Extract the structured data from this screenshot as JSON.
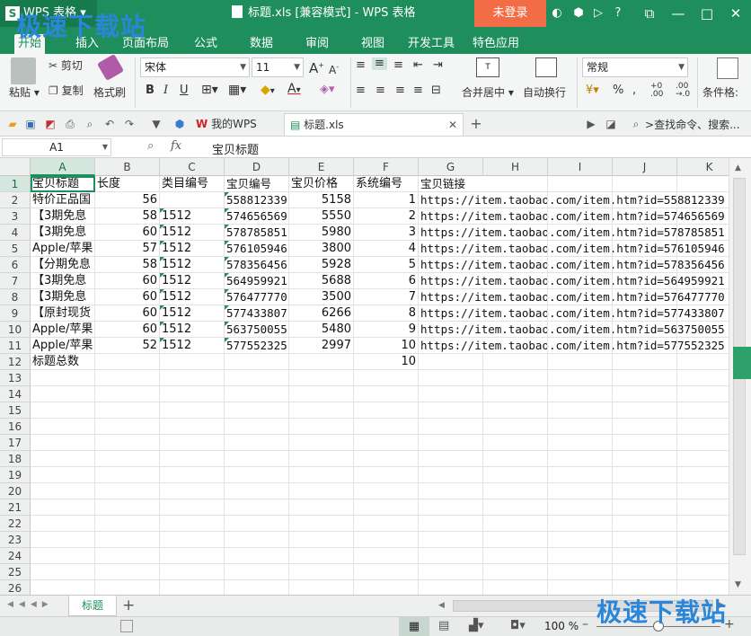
{
  "app": {
    "name": "WPS 表格",
    "window_title": "标题.xls [兼容模式] - WPS 表格",
    "login": "未登录"
  },
  "watermark": "极速下载站",
  "tabs": [
    "开始",
    "插入",
    "页面布局",
    "公式",
    "数据",
    "审阅",
    "视图",
    "开发工具",
    "特色应用"
  ],
  "ribbon": {
    "paste": "粘贴",
    "cut": "剪切",
    "copy": "复制",
    "format_painter": "格式刷",
    "font_name": "宋体",
    "font_size": "11",
    "bold": "B",
    "italic": "I",
    "underline": "U",
    "merge_center": "合并居中",
    "wrap_text": "自动换行",
    "number_format": "常规",
    "percent": "%",
    "conditional": "条件格:"
  },
  "quickbar": {
    "my_wps": "我的WPS",
    "file_tab": "标题.xls",
    "search": "查找命令、搜索..."
  },
  "formula_bar": {
    "cell_ref": "A1",
    "fx": "fx",
    "value": "宝贝标题"
  },
  "columns": [
    "A",
    "B",
    "C",
    "D",
    "E",
    "F",
    "G",
    "H",
    "I",
    "J",
    "K"
  ],
  "rows": [
    [
      "宝贝标题",
      "长度",
      "类目编号",
      "宝贝编号",
      "宝贝价格",
      "系统编号",
      "宝贝链接"
    ],
    [
      "特价正品国",
      "56",
      "",
      "558812339",
      "5158",
      "1",
      "https://item.taobao.com/item.htm?id=558812339"
    ],
    [
      "【3期免息",
      "58",
      "1512",
      "574656569",
      "5550",
      "2",
      "https://item.taobao.com/item.htm?id=574656569"
    ],
    [
      "【3期免息",
      "60",
      "1512",
      "578785851",
      "5980",
      "3",
      "https://item.taobao.com/item.htm?id=578785851"
    ],
    [
      "Apple/苹果",
      "57",
      "1512",
      "576105946",
      "3800",
      "4",
      "https://item.taobao.com/item.htm?id=576105946"
    ],
    [
      "【分期免息",
      "58",
      "1512",
      "578356456",
      "5928",
      "5",
      "https://item.taobao.com/item.htm?id=578356456"
    ],
    [
      "【3期免息",
      "60",
      "1512",
      "564959921",
      "5688",
      "6",
      "https://item.taobao.com/item.htm?id=564959921"
    ],
    [
      "【3期免息",
      "60",
      "1512",
      "576477770",
      "3500",
      "7",
      "https://item.taobao.com/item.htm?id=576477770"
    ],
    [
      "【原封现货",
      "60",
      "1512",
      "577433807",
      "6266",
      "8",
      "https://item.taobao.com/item.htm?id=577433807"
    ],
    [
      "Apple/苹果",
      "60",
      "1512",
      "563750055",
      "5480",
      "9",
      "https://item.taobao.com/item.htm?id=563750055"
    ],
    [
      "Apple/苹果",
      "52",
      "1512",
      "577552325",
      "2997",
      "10",
      "https://item.taobao.com/item.htm?id=577552325"
    ],
    [
      "标题总数",
      "",
      "",
      "",
      "",
      "10",
      ""
    ]
  ],
  "row_count": 26,
  "sheet_tab": "标题",
  "zoom": "100 %",
  "colors": {
    "accent": "#1e8e5c",
    "login": "#f26c45",
    "watermark": "#2a86d8"
  }
}
